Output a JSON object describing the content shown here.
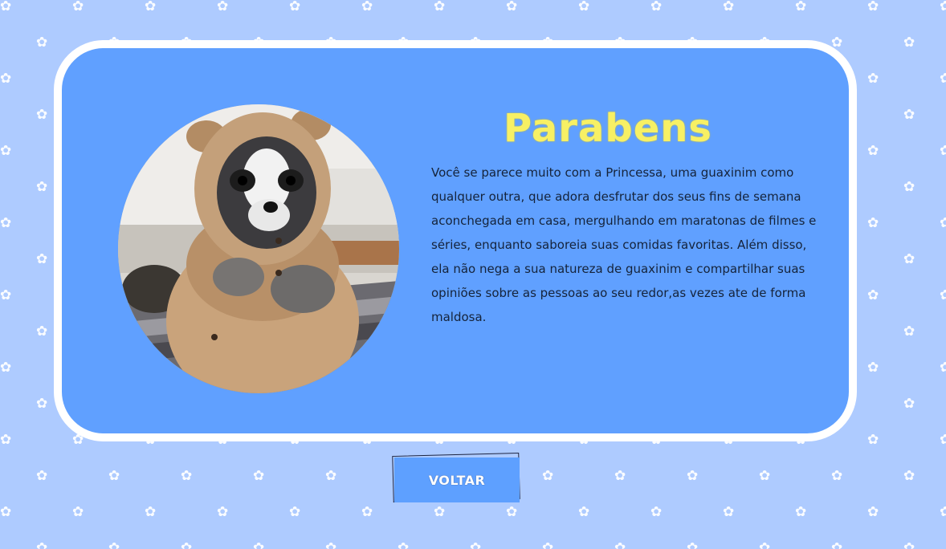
{
  "result": {
    "title": "Parabens",
    "description": "Você se parece muito com a Princessa, uma guaxinim como qualquer outra, que adora desfrutar dos seus fins de semana aconchegada em casa, mergulhando em maratonas de filmes e séries, enquanto saboreia suas comidas favoritas. Além disso, ela não nega a sua natureza de guaxinim e compartilhar suas opiniões sobre as pessoas ao seu redor,as vezes ate de forma maldosa.",
    "image_subject": "raccoon-in-teddy-hoodie"
  },
  "actions": {
    "back_label": "VOLTAR"
  },
  "theme": {
    "background": "#aecbff",
    "card": "#60a0ff",
    "card_border": "#ffffff",
    "title_color": "#f7f064",
    "text_color": "#15233a",
    "button_color": "#5ea0ff"
  },
  "background_pattern_icon": "paw-print-icon"
}
